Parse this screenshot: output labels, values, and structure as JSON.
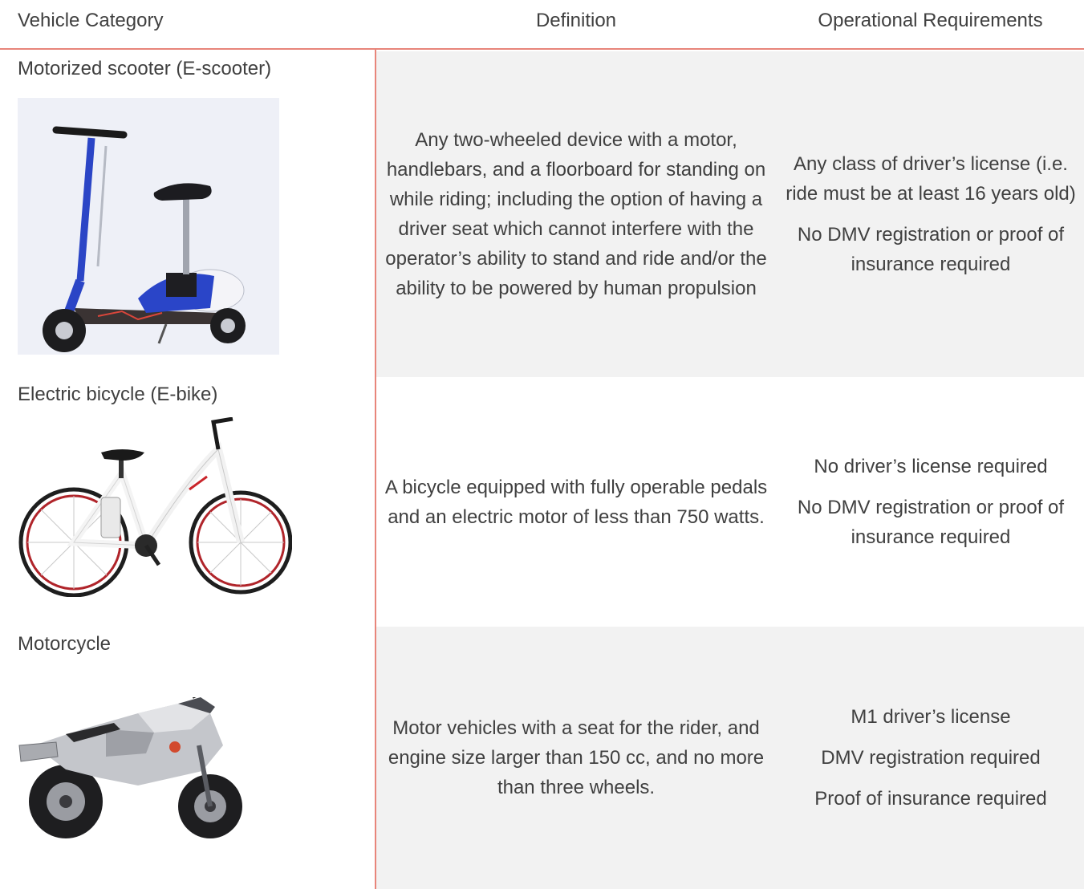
{
  "headers": {
    "category": "Vehicle Category",
    "definition": "Definition",
    "requirements": "Operational Requirements"
  },
  "rows": [
    {
      "category": "Motorized scooter (E-scooter)",
      "definition": "Any two-wheeled device with a motor, handlebars, and a floorboard for standing on while riding; including the option of having a driver seat which cannot interfere with the operator’s ability to stand and ride and/or the ability to be powered by human propulsion",
      "requirements": [
        "Any class of driver’s license (i.e. ride must be at least 16 years old)",
        "No DMV registration or proof of insurance required"
      ],
      "image": "e-scooter-photo"
    },
    {
      "category": "Electric bicycle (E-bike)",
      "definition": "A bicycle equipped with fully operable pedals and an electric motor of less than 750 watts.",
      "requirements": [
        "No driver’s license required",
        "No DMV registration or proof of insurance required"
      ],
      "image": "e-bike-photo"
    },
    {
      "category": "Motorcycle",
      "definition": "Motor vehicles with a seat for the rider, and engine size larger than 150 cc, and no more than three wheels.",
      "requirements": [
        "M1 driver’s license",
        "DMV registration required",
        "Proof of insurance required"
      ],
      "image": "motorcycle-photo"
    }
  ],
  "colors": {
    "accent": "#e8857a",
    "shade": "#f2f2f2",
    "text": "#404040"
  }
}
